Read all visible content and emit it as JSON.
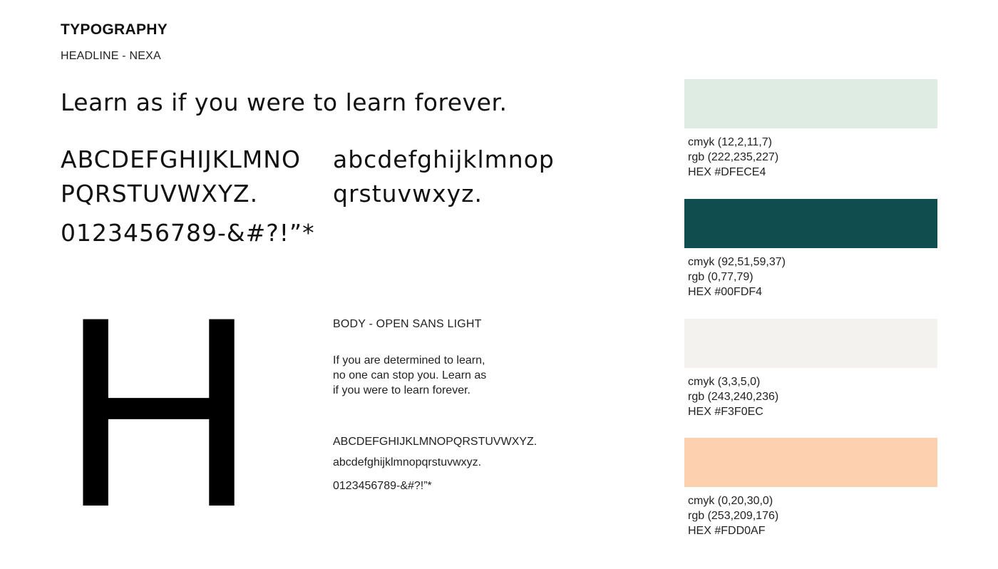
{
  "header": {
    "title": "TYPOGRAPHY",
    "headline_font_label": "HEADLINE - NEXA"
  },
  "headline": {
    "quote": "Learn as if you were to learn forever.",
    "uppercase_line1": "ABCDEFGHIJKLMNO",
    "uppercase_line2": "PQRSTUVWXYZ.",
    "lowercase_line1": "abcdefghijklmnop",
    "lowercase_line2": "qrstuvwxyz.",
    "numbers_symbols": "0123456789-&#?!”*",
    "big_letter": "H"
  },
  "body": {
    "font_label": "BODY - OPEN SANS LIGHT",
    "paragraph_line1": "If you are determined to learn,",
    "paragraph_line2": "no one can stop you. Learn as",
    "paragraph_line3": "if you were to learn forever.",
    "uppercase": "ABCDEFGHIJKLMNOPQRSTUVWXYZ.",
    "lowercase": "abcdefghijklmnopqrstuvwxyz.",
    "numbers_symbols": "0123456789-&#?!”*"
  },
  "palette": [
    {
      "color": "#DFECE4",
      "cmyk": "cmyk (12,2,11,7)",
      "rgb": "rgb (222,235,227)",
      "hex": "HEX #DFECE4"
    },
    {
      "color": "#0F4D4F",
      "cmyk": "cmyk (92,51,59,37)",
      "rgb": "rgb (0,77,79)",
      "hex": "HEX #00FDF4"
    },
    {
      "color": "#F3F2EE",
      "cmyk": "cmyk (3,3,5,0)",
      "rgb": "rgb (243,240,236)",
      "hex": "HEX #F3F0EC"
    },
    {
      "color": "#FDD0AF",
      "cmyk": "cmyk (0,20,30,0)",
      "rgb": "rgb (253,209,176)",
      "hex": "HEX #FDD0AF"
    }
  ]
}
